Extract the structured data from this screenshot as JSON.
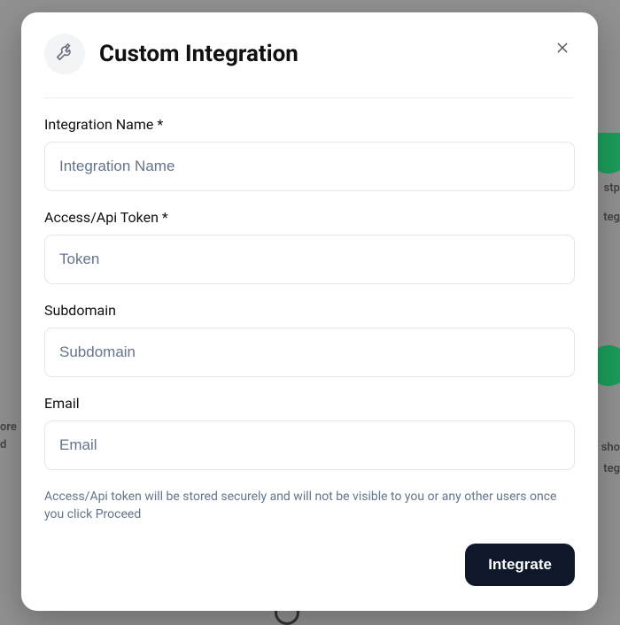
{
  "modal": {
    "title": "Custom Integration",
    "icon": "tools-icon",
    "close_icon": "close-icon",
    "fields": {
      "integration_name": {
        "label": "Integration Name *",
        "placeholder": "Integration Name",
        "value": ""
      },
      "token": {
        "label": "Access/Api Token *",
        "placeholder": "Token",
        "value": ""
      },
      "subdomain": {
        "label": "Subdomain",
        "placeholder": "Subdomain",
        "value": ""
      },
      "email": {
        "label": "Email",
        "placeholder": "Email",
        "value": ""
      }
    },
    "helper_text": "Access/Api token will be stored securely and will not be visible to you or any other users once you click Proceed",
    "submit_label": "Integrate"
  },
  "background": {
    "right_top_title": "stp",
    "right_top_sub": "teg",
    "right_bottom_title": "sho",
    "right_bottom_sub": "teg",
    "left_bottom_title": "ore",
    "left_bottom_sub": "d"
  }
}
